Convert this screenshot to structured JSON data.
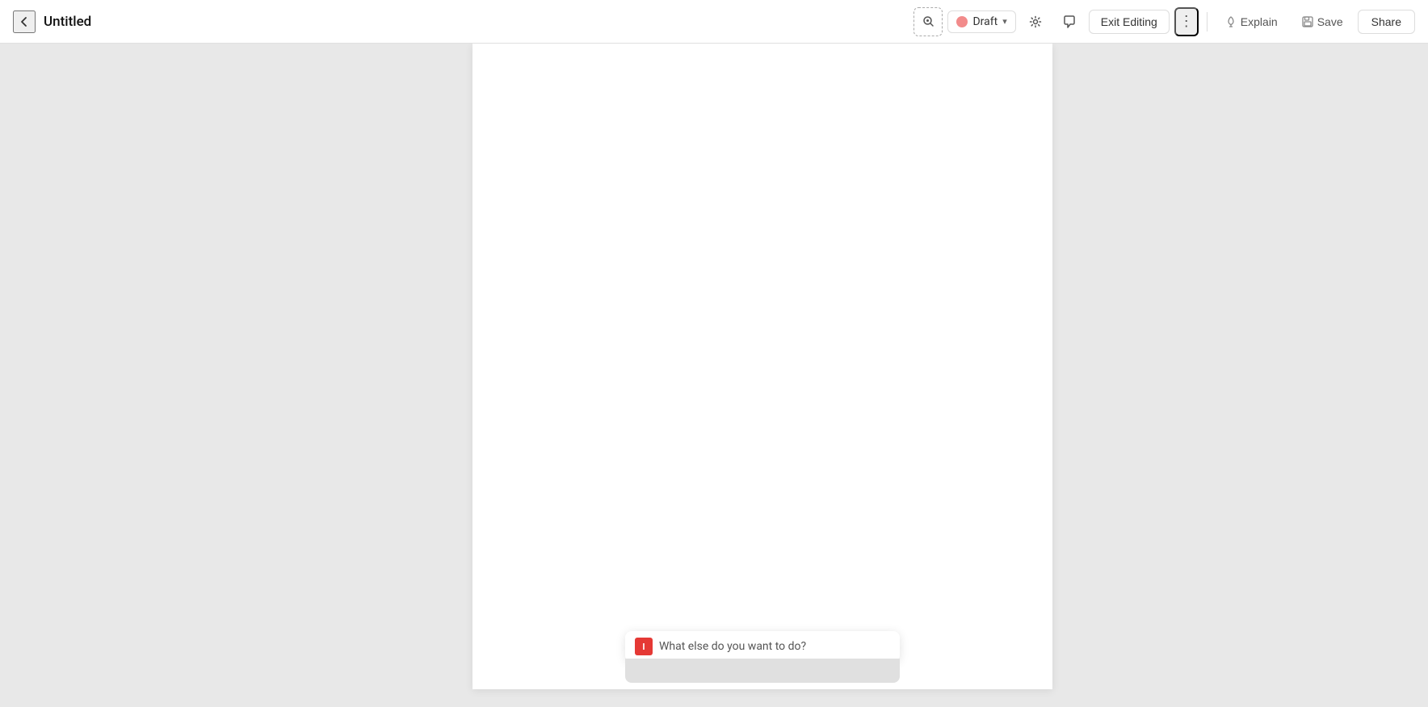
{
  "header": {
    "back_label": "←",
    "title": "Untitled",
    "search_icon": "🔍",
    "draft_label": "Draft",
    "draft_color": "#f28b8b",
    "settings_icon": "⚙",
    "comment_icon": "💬",
    "exit_editing_label": "Exit Editing",
    "more_icon": "⋮",
    "explain_icon": "💡",
    "explain_label": "Explain",
    "save_icon": "💾",
    "save_label": "Save",
    "share_label": "Share"
  },
  "main": {
    "doc_placeholder": ""
  },
  "input_bar": {
    "icon_label": "I",
    "placeholder": "What else do you want to do?"
  },
  "colors": {
    "background": "#e8e8e8",
    "header_bg": "#ffffff",
    "doc_bg": "#ffffff",
    "accent_red": "#e53935",
    "draft_color": "#f28b8b"
  }
}
